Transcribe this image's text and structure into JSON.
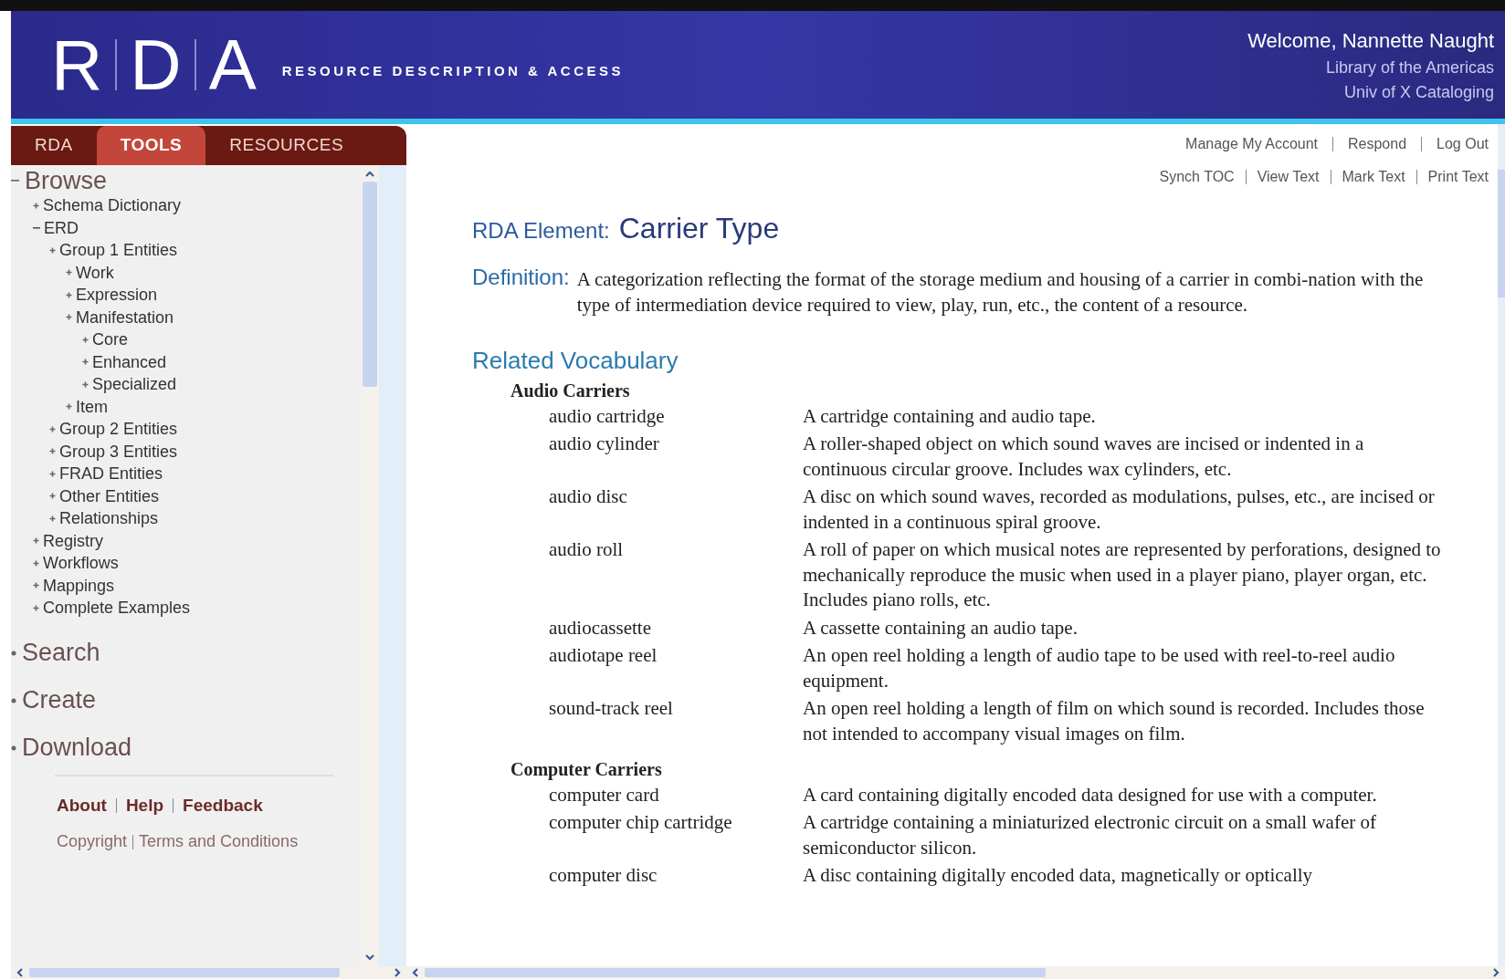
{
  "header": {
    "logo_letters": [
      "R",
      "D",
      "A"
    ],
    "tagline": "RESOURCE DESCRIPTION & ACCESS",
    "welcome": "Welcome, Nannette Naught",
    "org_lines": [
      "Library of the Americas",
      "Univ of X Cataloging"
    ]
  },
  "tabs": [
    {
      "label": "RDA",
      "selected": false
    },
    {
      "label": "TOOLS",
      "selected": true
    },
    {
      "label": "RESOURCES",
      "selected": false
    }
  ],
  "account_links": [
    "Manage My Account",
    "Respond",
    "Log Out"
  ],
  "text_links": [
    "Synch TOC",
    "View Text",
    "Mark Text",
    "Print Text"
  ],
  "sidebar": {
    "sections": [
      {
        "label": "Browse",
        "expanded": true,
        "children": [
          {
            "label": "Schema Dictionary",
            "expanded": false
          },
          {
            "label": "ERD",
            "expanded": true,
            "children": [
              {
                "label": "Group 1 Entities",
                "expanded": false,
                "children": [
                  {
                    "label": "Work",
                    "expanded": false
                  },
                  {
                    "label": "Expression",
                    "expanded": false
                  },
                  {
                    "label": "Manifestation",
                    "expanded": false,
                    "children": [
                      {
                        "label": "Core",
                        "expanded": false
                      },
                      {
                        "label": "Enhanced",
                        "expanded": false
                      },
                      {
                        "label": "Specialized",
                        "expanded": false
                      }
                    ]
                  },
                  {
                    "label": "Item",
                    "expanded": false
                  }
                ]
              },
              {
                "label": "Group 2 Entities",
                "expanded": false
              },
              {
                "label": "Group 3 Entities",
                "expanded": false
              },
              {
                "label": "FRAD Entities",
                "expanded": false
              },
              {
                "label": "Other Entities",
                "expanded": false
              },
              {
                "label": "Relationships",
                "expanded": false
              }
            ]
          },
          {
            "label": "Registry",
            "expanded": false
          },
          {
            "label": "Workflows",
            "expanded": false
          },
          {
            "label": "Mappings",
            "expanded": false
          },
          {
            "label": "Complete Examples",
            "expanded": false
          }
        ]
      },
      {
        "label": "Search",
        "expanded": false
      },
      {
        "label": "Create",
        "expanded": false
      },
      {
        "label": "Download",
        "expanded": false
      }
    ],
    "footer_links": [
      "About",
      "Help",
      "Feedback"
    ],
    "legal_links": [
      "Copyright",
      "Terms and Conditions"
    ]
  },
  "element": {
    "label": "RDA Element:",
    "name": "Carrier Type"
  },
  "definition": {
    "label": "Definition:",
    "text": "A categorization reflecting the format of the storage medium and housing of a carrier in combi-nation with the type of intermediation device required to view, play, run, etc., the content of a resource."
  },
  "vocabulary": {
    "title": "Related Vocabulary",
    "groups": [
      {
        "name": "Audio Carriers",
        "terms": [
          {
            "term": "audio cartridge",
            "definition": "A cartridge containing and audio tape."
          },
          {
            "term": "audio cylinder",
            "definition": "A roller-shaped object on which sound waves are incised or indented in a continuous circular groove. Includes wax cylinders, etc."
          },
          {
            "term": "audio disc",
            "definition": "A disc on which sound waves, recorded as modulations, pulses, etc., are incised or indented in a continuous spiral groove."
          },
          {
            "term": "audio roll",
            "definition": "A roll of paper on which musical notes are represented by perforations, designed to mechanically reproduce the music when used in a player piano, player organ, etc. Includes piano rolls, etc."
          },
          {
            "term": "audiocassette",
            "definition": "A cassette containing an audio tape."
          },
          {
            "term": "audiotape reel",
            "definition": "An open reel holding a length of audio tape to be used with reel-to-reel audio equipment."
          },
          {
            "term": "sound-track reel",
            "definition": "An open reel holding a length of film on which sound is recorded. Includes those not intended to accompany visual images on film."
          }
        ]
      },
      {
        "name": "Computer Carriers",
        "terms": [
          {
            "term": "computer card",
            "definition": "A card containing digitally encoded data designed for use with a computer."
          },
          {
            "term": "computer chip cartridge",
            "definition": "A cartridge containing a miniaturized electronic circuit on a small wafer of semiconductor silicon."
          },
          {
            "term": "computer disc",
            "definition": "A disc containing digitally encoded data, magnetically or optically"
          }
        ]
      }
    ]
  }
}
